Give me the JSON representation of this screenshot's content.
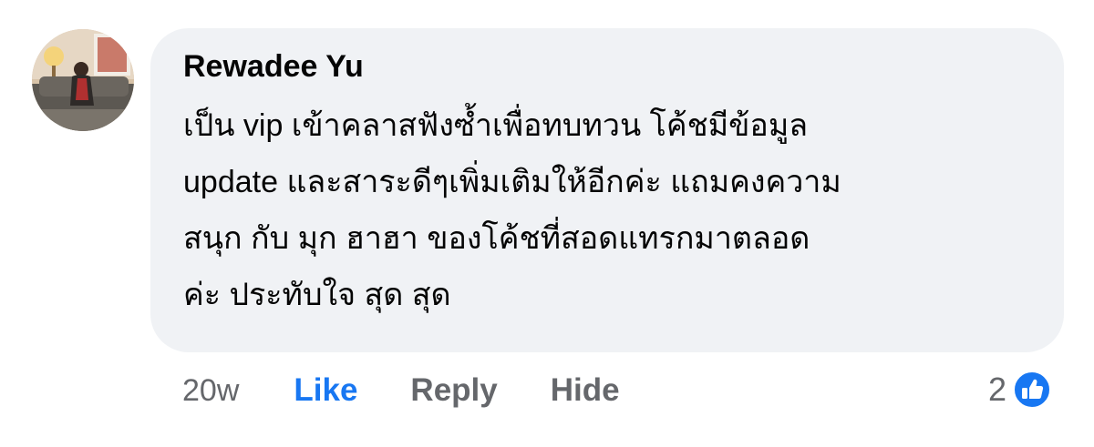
{
  "comment": {
    "author": "Rewadee Yu",
    "text_lines": [
      "เป็น vip  เข้าคลาสฟังซ้ำเพื่อทบทวน โค้ชมีข้อมูล",
      "update และสาระดีๆเพิ่มเติมให้อีกค่ะ แถมคงความ",
      "สนุก กับ มุก ฮาฮา ของโค้ชที่สอดแทรกมาตลอด",
      "ค่ะ  ประทับใจ สุด สุด"
    ]
  },
  "actions": {
    "time": "20w",
    "like_label": "Like",
    "reply_label": "Reply",
    "hide_label": "Hide"
  },
  "reactions": {
    "count": "2",
    "icon": "thumbs-up-icon",
    "color": "#1877f2"
  },
  "colors": {
    "bubble": "#f0f2f5",
    "text": "#050505",
    "secondary": "#65676b",
    "accent": "#1877f2"
  }
}
